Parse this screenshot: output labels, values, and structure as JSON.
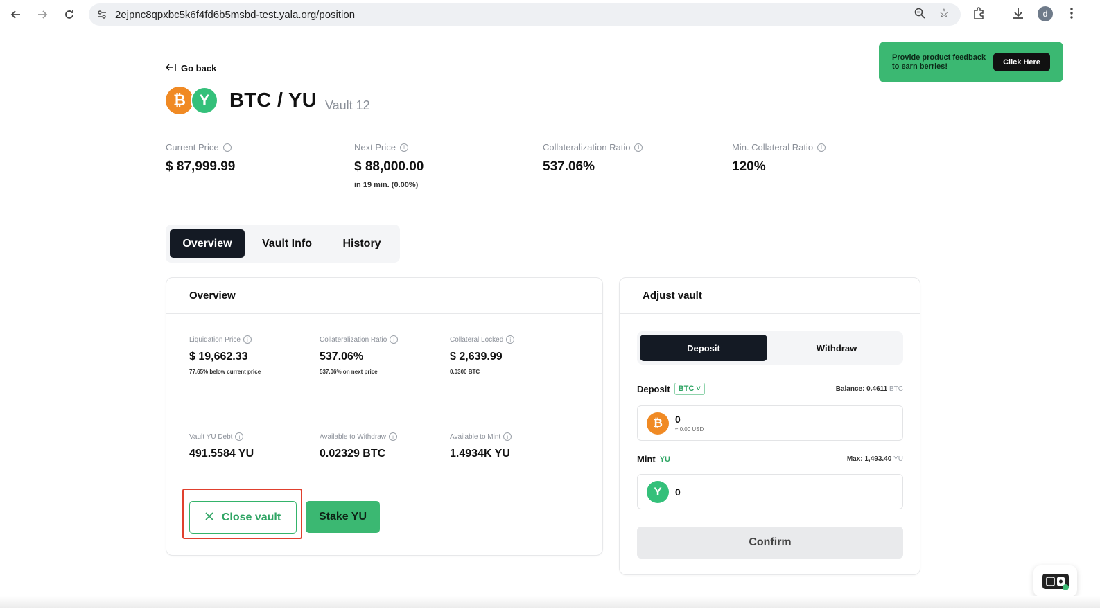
{
  "browser": {
    "url": "2ejpnc8qpxbc5k6f4fd6b5msbd-test.yala.org/position",
    "profile_initial": "d"
  },
  "nav": {
    "go_back": "Go back"
  },
  "feedback": {
    "text": "Provide product feedback to earn berries!",
    "button": "Click Here"
  },
  "header": {
    "pair": "BTC / YU",
    "vault": "Vault 12",
    "btc_symbol": "₿",
    "yu_symbol": "Y"
  },
  "stats": [
    {
      "label": "Current Price",
      "value": "$ 87,999.99",
      "sub": ""
    },
    {
      "label": "Next Price",
      "value": "$ 88,000.00",
      "sub": "in 19 min. (0.00%)"
    },
    {
      "label": "Collateralization Ratio",
      "value": "537.06%",
      "sub": ""
    },
    {
      "label": "Min. Collateral Ratio",
      "value": "120%",
      "sub": ""
    }
  ],
  "tabs": [
    "Overview",
    "Vault Info",
    "History"
  ],
  "overview": {
    "title": "Overview",
    "items": [
      {
        "label": "Liquidation Price",
        "value": "$ 19,662.33",
        "sub": "77.65% below current price"
      },
      {
        "label": "Collateralization Ratio",
        "value": "537.06%",
        "sub": "537.06% on next price"
      },
      {
        "label": "Collateral Locked",
        "value": "$ 2,639.99",
        "sub": "0.0300 BTC"
      },
      {
        "label": "Vault YU Debt",
        "value": "491.5584 YU",
        "sub": ""
      },
      {
        "label": "Available to Withdraw",
        "value": "0.02329 BTC",
        "sub": ""
      },
      {
        "label": "Available to Mint",
        "value": "1.4934K YU",
        "sub": ""
      }
    ],
    "close_button": "Close vault",
    "stake_button": "Stake YU"
  },
  "adjust": {
    "title": "Adjust vault",
    "tabs": [
      "Deposit",
      "Withdraw"
    ],
    "deposit_label": "Deposit",
    "deposit_token": "BTC",
    "balance_label": "Balance: 0.4611",
    "balance_unit": "BTC",
    "deposit_value": "0",
    "deposit_usd": "≈ 0.00 USD",
    "mint_label": "Mint",
    "mint_token": "YU",
    "max_label": "Max: 1,493.40",
    "max_unit": "YU",
    "mint_value": "0",
    "confirm": "Confirm"
  },
  "colors": {
    "accent_green": "#3bb872",
    "btc_orange": "#f08a24",
    "dark": "#141a24",
    "highlight_red": "#e0402e"
  }
}
